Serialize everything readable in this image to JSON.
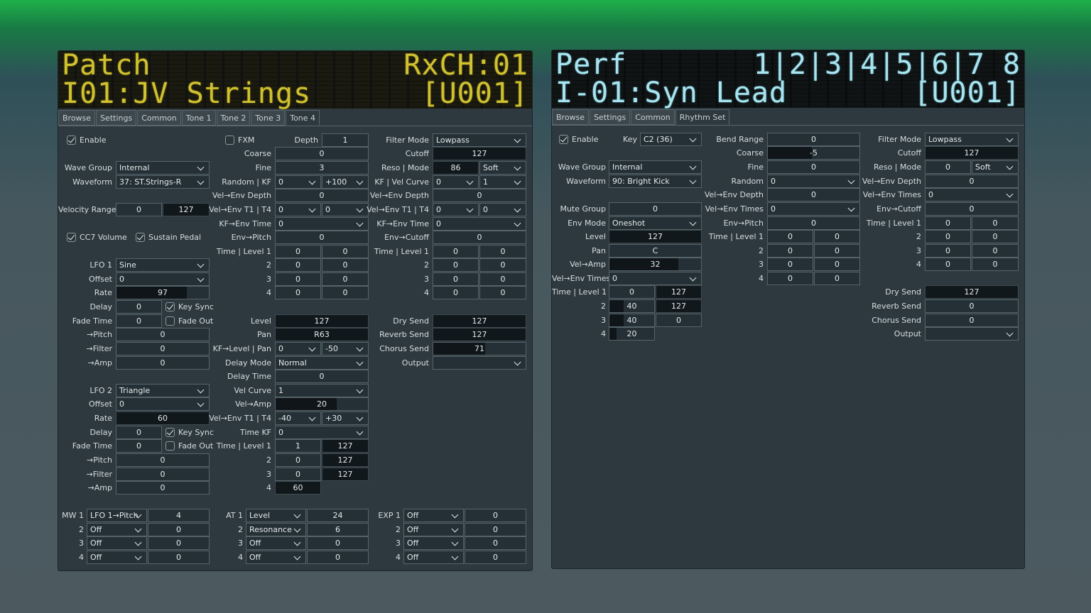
{
  "patch": {
    "lcd": {
      "l1": "Patch",
      "r1": "RxCH:01",
      "l2": "I01:JV Strings",
      "r2": "[U001]"
    },
    "tabs": [
      "Browse",
      "Settings",
      "Common",
      "Tone 1",
      "Tone 2",
      "Tone 3",
      "Tone 4"
    ],
    "active_tab": "Tone 4",
    "labels": {
      "enable": "Enable",
      "fxm": "FXM",
      "depth": "Depth",
      "coarse": "Coarse",
      "fine": "Fine",
      "wave_group": "Wave Group",
      "waveform": "Waveform",
      "random_kf": "Random | KF",
      "vel_env_depth": "Vel→Env Depth",
      "velocity_range": "Velocity Range",
      "vel_env_t1t4": "Vel→Env T1 | T4",
      "kf_env_time": "KF→Env Time",
      "cc7_volume": "CC7 Volume",
      "sustain_pedal": "Sustain Pedal",
      "env_pitch": "Env→Pitch",
      "time_level_1": "Time | Level 1",
      "n2": "2",
      "n3": "3",
      "n4": "4",
      "lfo1": "LFO 1",
      "lfo2": "LFO 2",
      "offset": "Offset",
      "rate": "Rate",
      "delay": "Delay",
      "key_sync": "Key Sync",
      "fade_time": "Fade Time",
      "fade_out": "Fade Out",
      "to_pitch": "→Pitch",
      "to_filter": "→Filter",
      "to_amp": "→Amp",
      "level": "Level",
      "pan": "Pan",
      "kf_level_pan": "KF→Level | Pan",
      "delay_mode": "Delay Mode",
      "delay_time": "Delay Time",
      "vel_curve": "Vel Curve",
      "vel_amp": "Vel→Amp",
      "time_kf": "Time KF",
      "filter_mode": "Filter Mode",
      "cutoff": "Cutoff",
      "reso_mode": "Reso | Mode",
      "kf_vel_curve": "KF | Vel Curve",
      "env_cutoff": "Env→Cutoff",
      "dry_send": "Dry Send",
      "reverb_send": "Reverb Send",
      "chorus_send": "Chorus Send",
      "output": "Output",
      "mw1": "MW 1",
      "at1": "AT 1",
      "exp1": "EXP 1"
    },
    "values": {
      "enable": true,
      "fxm": false,
      "depth": "1",
      "coarse": "0",
      "fine": "3",
      "wave_group": "Internal",
      "waveform": "37: ST.Strings-R",
      "random": "0",
      "kf": "+100",
      "vel_env_depth_p": "0",
      "vel_lo": "0",
      "vel_hi": "127",
      "p_t1": "0",
      "p_t4": "0",
      "p_kf_env": "0",
      "cc7": true,
      "sustain": true,
      "env_pitch": "0",
      "p_env": [
        [
          "0",
          "0"
        ],
        [
          "0",
          "0"
        ],
        [
          "0",
          "0"
        ],
        [
          "0",
          "0"
        ]
      ],
      "lfo1_wave": "Sine",
      "lfo1_offset": "0",
      "lfo1_rate": "97",
      "lfo1_delay": "0",
      "lfo1_keysync": true,
      "lfo1_fade_time": "0",
      "lfo1_fadeout": false,
      "lfo1_pitch": "0",
      "lfo1_filter": "0",
      "lfo1_amp": "0",
      "lfo2_wave": "Triangle",
      "lfo2_offset": "0",
      "lfo2_rate": "60",
      "lfo2_delay": "0",
      "lfo2_keysync": true,
      "lfo2_fade_time": "0",
      "lfo2_fadeout": false,
      "lfo2_pitch": "0",
      "lfo2_filter": "0",
      "lfo2_amp": "0",
      "level": "127",
      "pan": "R63",
      "kf_level": "0",
      "kf_pan": "-50",
      "delay_mode": "Normal",
      "delay_time": "0",
      "vel_curve": "1",
      "vel_amp": "20",
      "a_t1": "-40",
      "a_t4": "+30",
      "time_kf": "0",
      "a_env": [
        [
          "1",
          "127"
        ],
        [
          "0",
          "127"
        ],
        [
          "0",
          "127"
        ],
        [
          "60",
          ""
        ]
      ],
      "filter_mode": "Lowpass",
      "cutoff": "127",
      "reso": "86",
      "reso_mode": "Soft",
      "f_kf": "0",
      "f_vel_curve": "1",
      "f_vel_env_depth": "0",
      "f_t1": "0",
      "f_t4": "0",
      "f_kf_env": "0",
      "env_cutoff": "0",
      "f_env": [
        [
          "0",
          "0"
        ],
        [
          "0",
          "0"
        ],
        [
          "0",
          "0"
        ],
        [
          "0",
          "0"
        ]
      ],
      "dry_send": "127",
      "reverb_send": "127",
      "chorus_send": "71",
      "output": "",
      "mw": [
        [
          "LFO 1→Pitch",
          "4"
        ],
        [
          "Off",
          "0"
        ],
        [
          "Off",
          "0"
        ],
        [
          "Off",
          "0"
        ]
      ],
      "at": [
        [
          "Level",
          "24"
        ],
        [
          "Resonance",
          "6"
        ],
        [
          "Off",
          "0"
        ],
        [
          "Off",
          "0"
        ]
      ],
      "exp": [
        [
          "Off",
          "0"
        ],
        [
          "Off",
          "0"
        ],
        [
          "Off",
          "0"
        ],
        [
          "Off",
          "0"
        ]
      ]
    }
  },
  "perf": {
    "lcd": {
      "l1": "Perf",
      "r1": "1|2|3|4|5|6|7 8",
      "l2": "I-01:Syn Lead",
      "r2": "[U001]"
    },
    "tabs": [
      "Browse",
      "Settings",
      "Common",
      "Rhythm Set"
    ],
    "active_tab": "Rhythm Set",
    "labels": {
      "enable": "Enable",
      "key": "Key",
      "bend_range": "Bend Range",
      "coarse": "Coarse",
      "fine": "Fine",
      "wave_group": "Wave Group",
      "waveform": "Waveform",
      "random": "Random",
      "vel_env_depth": "Vel→Env Depth",
      "vel_env_times": "Vel→Env Times",
      "mute_group": "Mute Group",
      "env_mode": "Env Mode",
      "env_pitch": "Env→Pitch",
      "level": "Level",
      "time_level_1": "Time | Level 1",
      "pan": "Pan",
      "vel_amp": "Vel→Amp",
      "n2": "2",
      "n3": "3",
      "n4": "4",
      "filter_mode": "Filter Mode",
      "cutoff": "Cutoff",
      "reso_mode": "Reso | Mode",
      "env_cutoff": "Env→Cutoff",
      "dry_send": "Dry Send",
      "reverb_send": "Reverb Send",
      "chorus_send": "Chorus Send",
      "output": "Output"
    },
    "values": {
      "enable": true,
      "key": "C2 (36)",
      "bend_range": "0",
      "coarse": "-5",
      "fine": "0",
      "wave_group": "Internal",
      "waveform": "90: Bright Kick",
      "random": "0",
      "p_vel_env_depth": "0",
      "p_vel_env_times": "0",
      "mute_group": "0",
      "env_mode": "Oneshot",
      "env_pitch": "0",
      "p_env": [
        [
          "0",
          "0"
        ],
        [
          "0",
          "0"
        ],
        [
          "0",
          "0"
        ],
        [
          "0",
          "0"
        ]
      ],
      "level": "127",
      "pan": "C",
      "vel_amp": "32",
      "a_vel_env_times": "0",
      "a_env": [
        [
          "0",
          "127"
        ],
        [
          "40",
          "127"
        ],
        [
          "40",
          "0"
        ],
        [
          "20",
          ""
        ]
      ],
      "filter_mode": "Lowpass",
      "cutoff": "127",
      "reso": "0",
      "reso_mode": "Soft",
      "f_vel_env_depth": "0",
      "f_vel_env_times": "0",
      "env_cutoff": "0",
      "f_env": [
        [
          "0",
          "0"
        ],
        [
          "0",
          "0"
        ],
        [
          "0",
          "0"
        ],
        [
          "0",
          "0"
        ]
      ],
      "dry_send": "127",
      "reverb_send": "0",
      "chorus_send": "0",
      "output": ""
    }
  }
}
